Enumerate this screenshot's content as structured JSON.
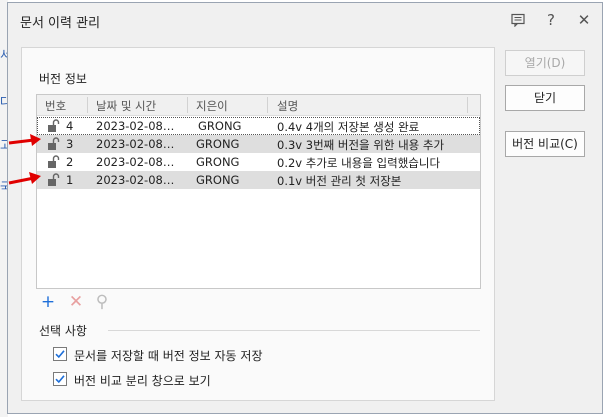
{
  "background": {
    "chars": [
      "서",
      "다",
      "고",
      "국"
    ]
  },
  "dialog": {
    "title": "문서 이력 관리",
    "titlebar_icons": [
      "feedback-icon",
      "help-icon",
      "close-icon"
    ],
    "help_glyph": "?",
    "close_glyph": "✕"
  },
  "version_info": {
    "label": "버전 정보",
    "columns": [
      "번호",
      "날짜 및 시간",
      "지은이",
      "설명"
    ],
    "rows": [
      {
        "number": "4",
        "datetime": "2023-02-08…",
        "author": "GRONG",
        "description": "0.4v 4개의 저장본 생성 완료",
        "selected": false,
        "focused": true
      },
      {
        "number": "3",
        "datetime": "2023-02-08…",
        "author": "GRONG",
        "description": "0.3v 3번째 버전을 위한 내용 추가",
        "selected": true,
        "focused": false
      },
      {
        "number": "2",
        "datetime": "2023-02-08…",
        "author": "GRONG",
        "description": "0.2v 추가로 내용을 입력했습니다",
        "selected": false,
        "focused": false
      },
      {
        "number": "1",
        "datetime": "2023-02-08…",
        "author": "GRONG",
        "description": "0.1v 버전 관리 첫 저장본",
        "selected": true,
        "focused": false
      }
    ]
  },
  "toolbar": {
    "add_glyph": "+",
    "delete_glyph": "✕",
    "search_glyph": "⚲"
  },
  "options": {
    "label": "선택 사항",
    "items": [
      {
        "label": "문서를 저장할 때 버전 정보 자동 저장",
        "checked": true
      },
      {
        "label": "버전 비교 분리 창으로 보기",
        "checked": true
      }
    ]
  },
  "buttons": {
    "open": "열기(D)",
    "close": "닫기",
    "compare": "버전 비교(C)"
  },
  "colors": {
    "arrow": "#e00000",
    "add": "#1e6fd9",
    "selected_row": "#dedede"
  }
}
